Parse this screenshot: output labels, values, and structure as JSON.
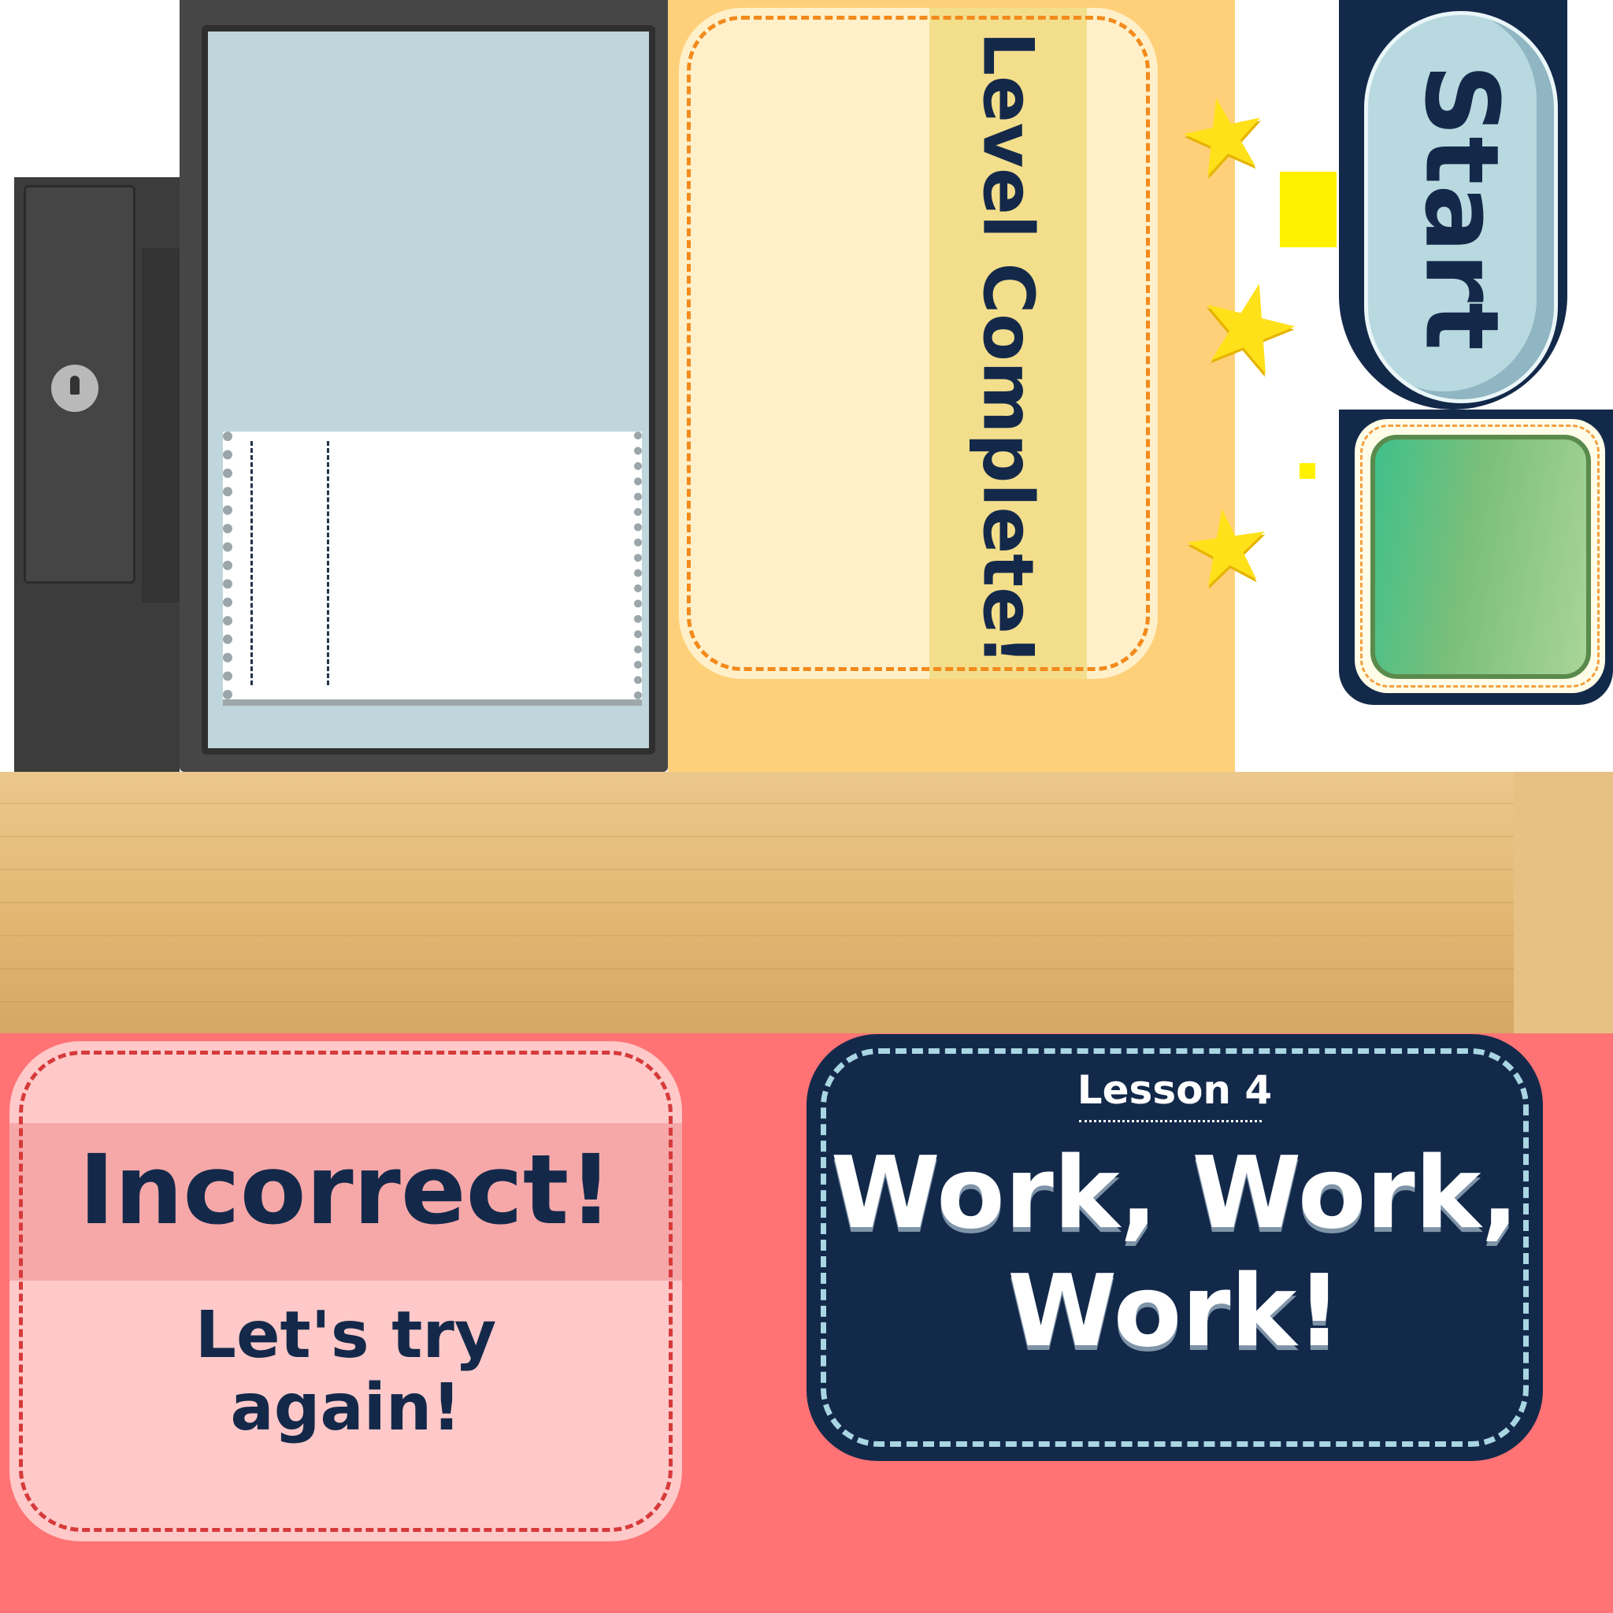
{
  "level_complete": {
    "title": "Level Complete!"
  },
  "start_button": {
    "label": "Start"
  },
  "incorrect_panel": {
    "title": "Incorrect!",
    "subtitle_line1": "Let's try",
    "subtitle_line2": "again!"
  },
  "lesson_panel": {
    "lesson_label": "Lesson 4",
    "title_line1": "Work, Work,",
    "title_line2": "Work!"
  },
  "icons": [
    "keyhole-icon",
    "star-icon",
    "star-icon",
    "star-icon"
  ],
  "colors": {
    "level_background": "#ffd07a",
    "start_button": "#b9d9e0",
    "green_button": "#7bbf7a",
    "incorrect_background": "#ff7374",
    "lesson_card": "#13294a",
    "text_dark": "#14294a"
  }
}
